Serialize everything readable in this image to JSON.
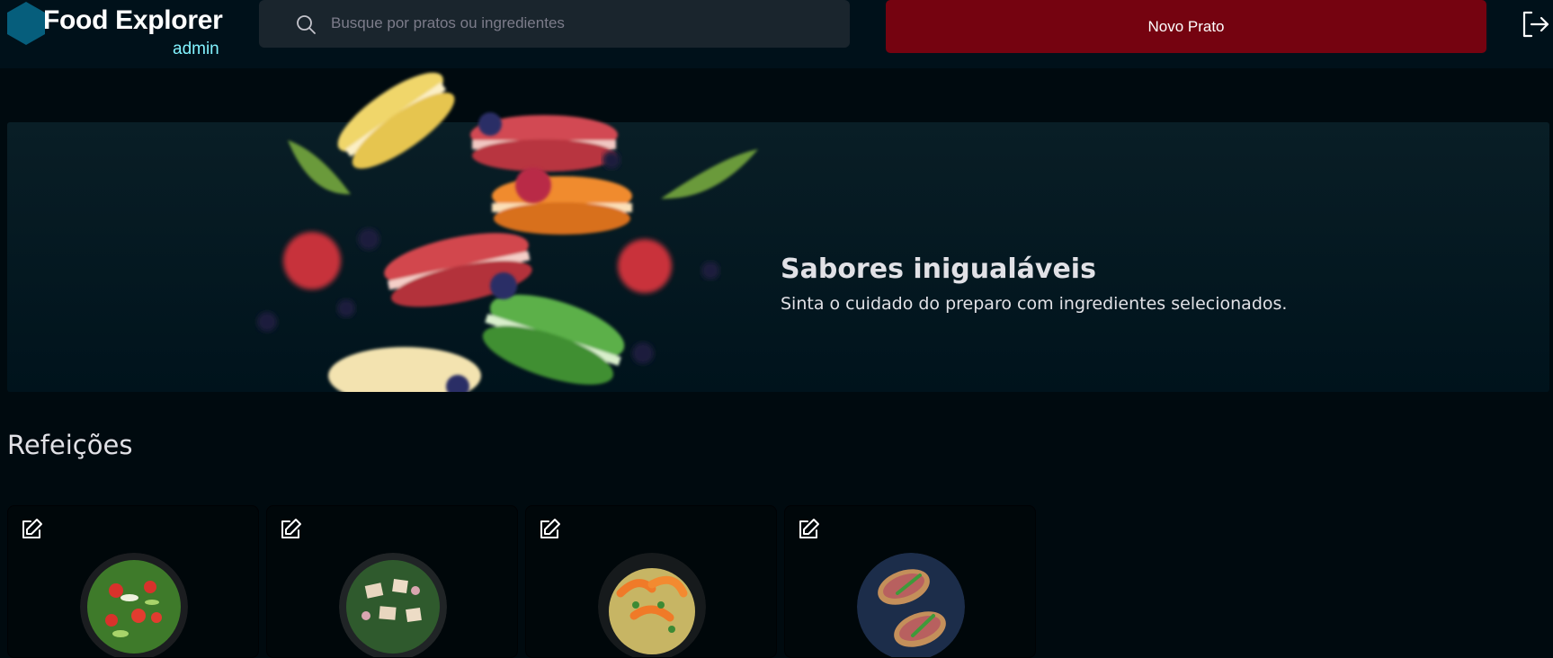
{
  "header": {
    "brand": "Food Explorer",
    "role": "admin",
    "search_placeholder": "Busque por pratos ou ingredientes",
    "new_dish_label": "Novo Prato",
    "icons": {
      "logo": "hexagon-logo-icon",
      "search": "search-icon",
      "logout": "sign-out-icon"
    }
  },
  "banner": {
    "title": "Sabores inigualáveis",
    "subtitle": "Sinta o cuidado do preparo com ingredientes selecionados."
  },
  "section": {
    "title": "Refeições",
    "cards": [
      {
        "image": "salad-dish-image",
        "edit_icon": "pencil-square-icon"
      },
      {
        "image": "caesar-salad-dish-image",
        "edit_icon": "pencil-square-icon"
      },
      {
        "image": "shrimp-pasta-dish-image",
        "edit_icon": "pencil-square-icon"
      },
      {
        "image": "bruschetta-dish-image",
        "edit_icon": "pencil-square-icon"
      }
    ]
  },
  "colors": {
    "page_bg": "#000a0f",
    "header_bg": "#00111a",
    "accent_red": "#750310",
    "accent_cyan": "#82f3ff",
    "logo_blue": "#065e7c"
  }
}
